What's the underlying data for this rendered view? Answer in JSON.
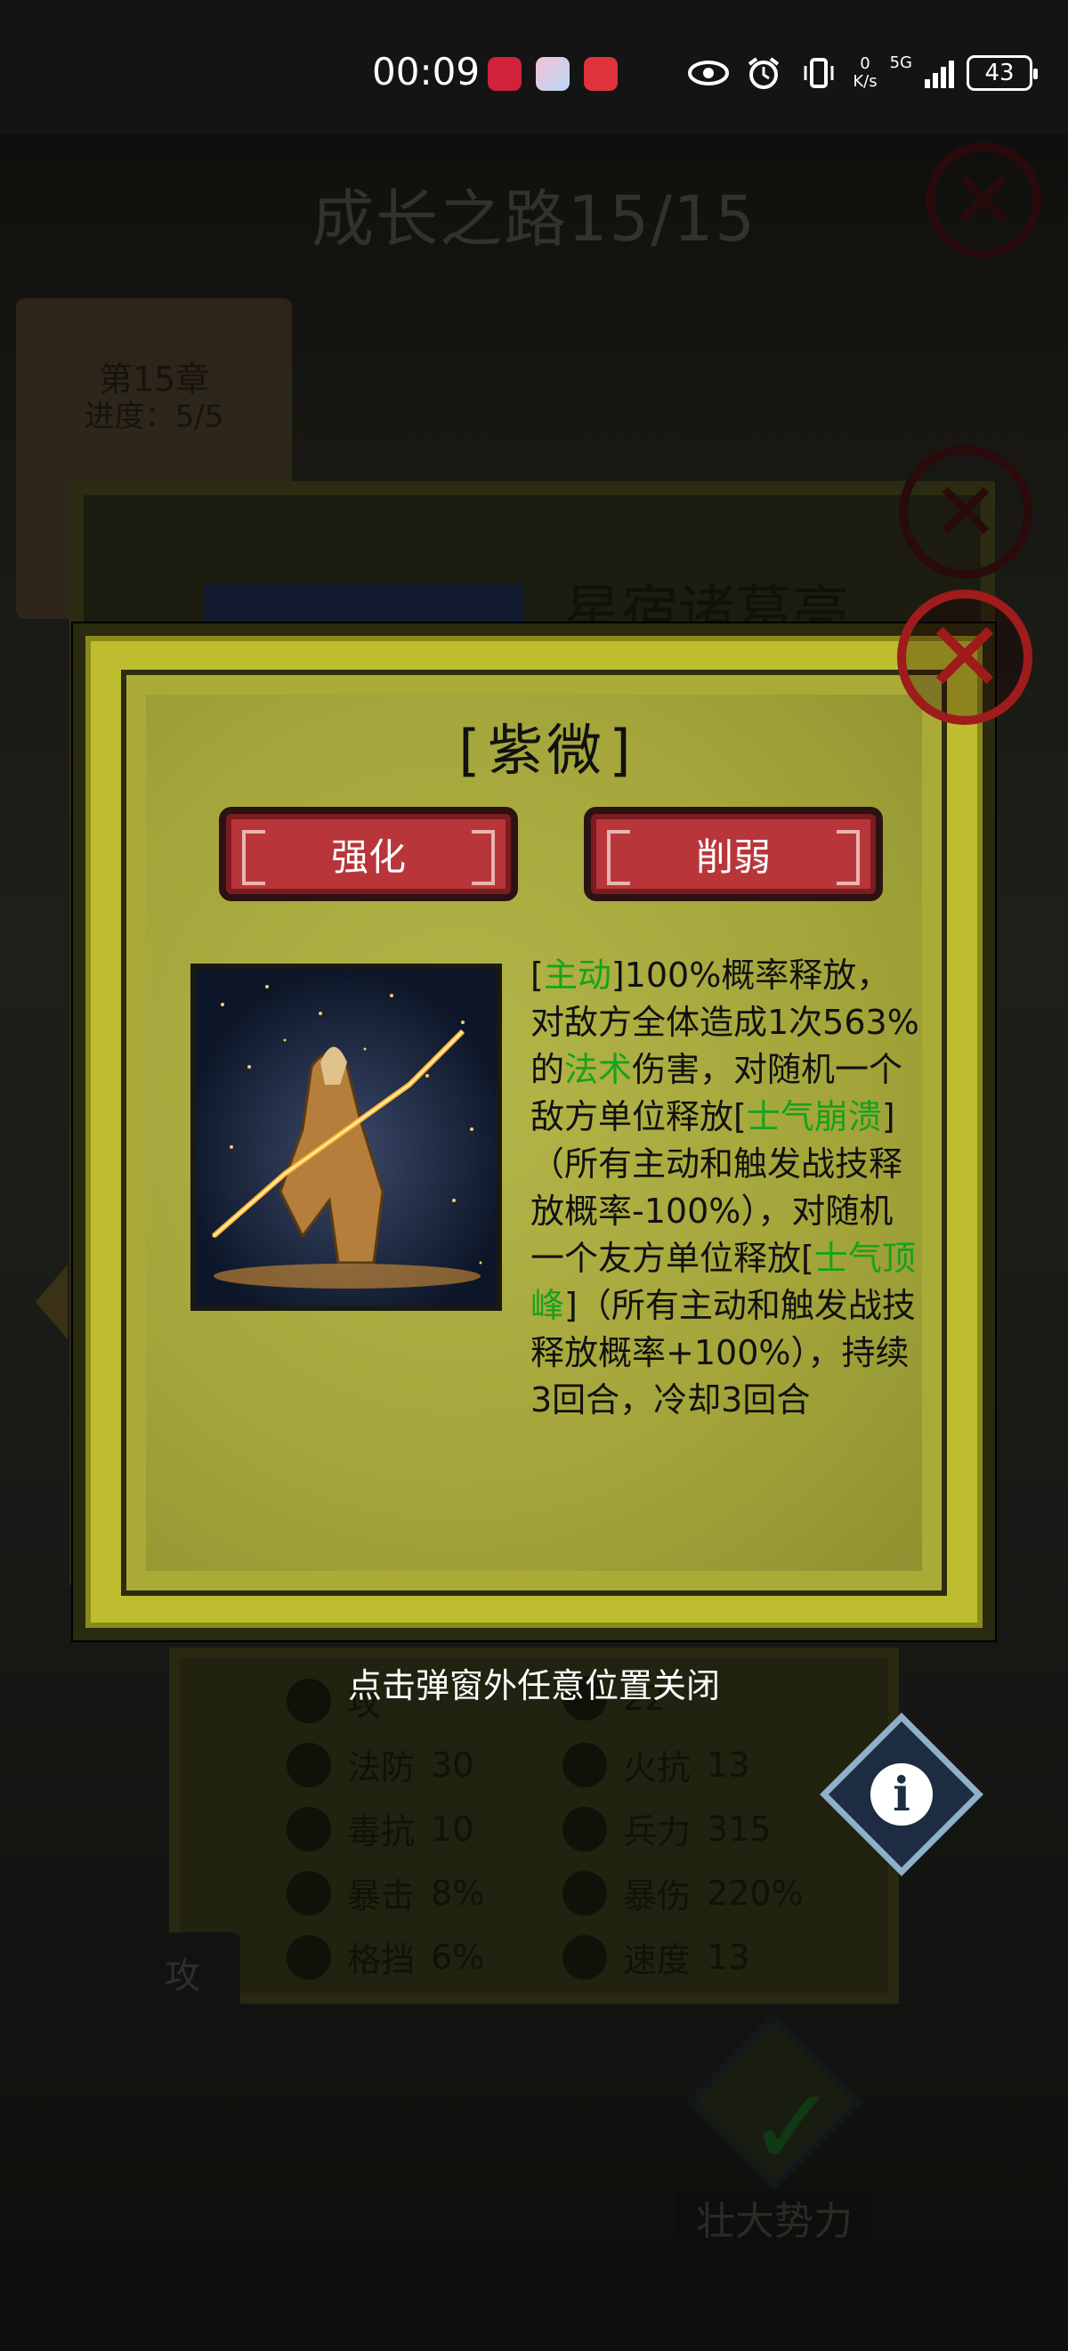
{
  "status_bar": {
    "time": "00:09",
    "net_speed_value": "0",
    "net_speed_unit": "K/s",
    "network_type": "5G",
    "battery": "43"
  },
  "background": {
    "page_title": "成长之路15/15",
    "chapter": "第15章",
    "progress": "进度：5/5",
    "hero_name": "星宿诸葛亮",
    "attack_label": "攻",
    "grow_button": "壮大势力",
    "stats": [
      {
        "label": "攻",
        "value": ""
      },
      {
        "label": "",
        "value": "22"
      },
      {
        "label": "法防",
        "value": "30"
      },
      {
        "label": "火抗",
        "value": "13"
      },
      {
        "label": "毒抗",
        "value": "10"
      },
      {
        "label": "兵力",
        "value": "315"
      },
      {
        "label": "暴击",
        "value": "8%"
      },
      {
        "label": "暴伤",
        "value": "220%"
      },
      {
        "label": "格挡",
        "value": "6%"
      },
      {
        "label": "速度",
        "value": "13"
      }
    ]
  },
  "popup": {
    "title": "[紫微]",
    "strengthen_label": "强化",
    "weaken_label": "削弱",
    "skill_parts": [
      {
        "text": "[",
        "kw": false
      },
      {
        "text": "主动",
        "kw": true
      },
      {
        "text": "]100%概率释放，对敌方全体造成1次563%的",
        "kw": false
      },
      {
        "text": "法术",
        "kw": true
      },
      {
        "text": "伤害，对随机一个敌方单位释放[",
        "kw": false
      },
      {
        "text": "士气崩溃",
        "kw": true
      },
      {
        "text": "]（所有主动和触发战技释放概率-100%），对随机一个友方单位释放[",
        "kw": false
      },
      {
        "text": "士气顶峰",
        "kw": true
      },
      {
        "text": "]（所有主动和触发战技释放概率+100%），持续3回合，冷却3回合",
        "kw": false
      }
    ]
  },
  "hint": "点击弹窗外任意位置关闭",
  "colors": {
    "popup_bg": "#bdbd2f",
    "keyword": "#17a21c",
    "button": "#b8363a",
    "close": "#9e1c1c"
  }
}
